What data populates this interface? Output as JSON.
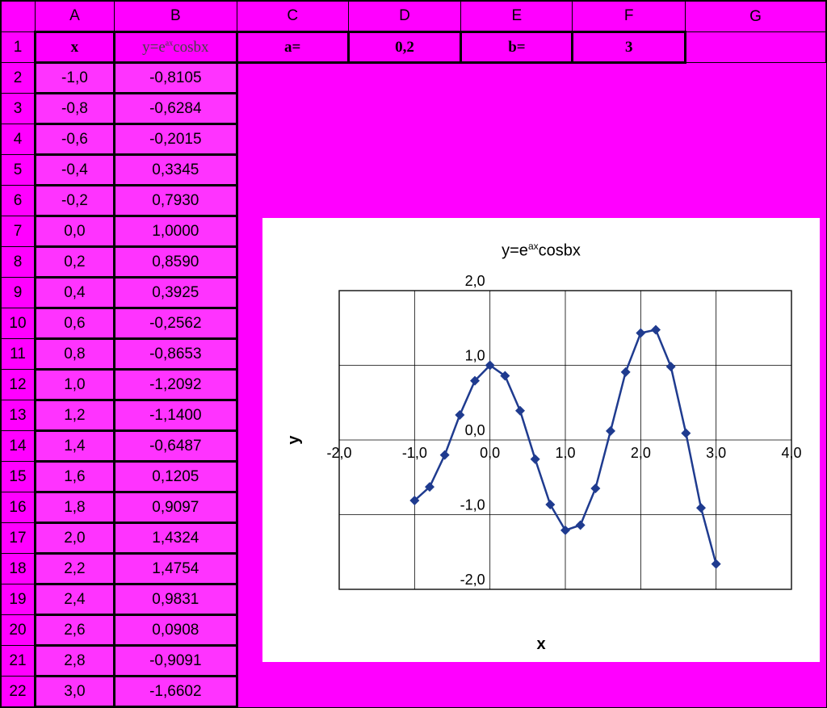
{
  "columns": [
    "A",
    "B",
    "C",
    "D",
    "E",
    "F",
    "G"
  ],
  "row_numbers": [
    1,
    2,
    3,
    4,
    5,
    6,
    7,
    8,
    9,
    10,
    11,
    12,
    13,
    14,
    15,
    16,
    17,
    18,
    19,
    20,
    21,
    22
  ],
  "header_row": {
    "A": "x",
    "B_html": "y=e<sup>ax</sup>cosbx",
    "C": "a=",
    "D": "0,2",
    "E": "b=",
    "F": "3"
  },
  "data_rows": [
    {
      "x": "-1,0",
      "y": "-0,8105"
    },
    {
      "x": "-0,8",
      "y": "-0,6284"
    },
    {
      "x": "-0,6",
      "y": "-0,2015"
    },
    {
      "x": "-0,4",
      "y": "0,3345"
    },
    {
      "x": "-0,2",
      "y": "0,7930"
    },
    {
      "x": "0,0",
      "y": "1,0000"
    },
    {
      "x": "0,2",
      "y": "0,8590"
    },
    {
      "x": "0,4",
      "y": "0,3925"
    },
    {
      "x": "0,6",
      "y": "-0,2562"
    },
    {
      "x": "0,8",
      "y": "-0,8653"
    },
    {
      "x": "1,0",
      "y": "-1,2092"
    },
    {
      "x": "1,2",
      "y": "-1,1400"
    },
    {
      "x": "1,4",
      "y": "-0,6487"
    },
    {
      "x": "1,6",
      "y": "0,1205"
    },
    {
      "x": "1,8",
      "y": "0,9097"
    },
    {
      "x": "2,0",
      "y": "1,4324"
    },
    {
      "x": "2,2",
      "y": "1,4754"
    },
    {
      "x": "2,4",
      "y": "0,9831"
    },
    {
      "x": "2,6",
      "y": "0,0908"
    },
    {
      "x": "2,8",
      "y": "-0,9091"
    },
    {
      "x": "3,0",
      "y": "-1,6602"
    }
  ],
  "chart_data": {
    "type": "line",
    "title_html": "y=e<sup>ax</sup>cosbx",
    "xlabel": "x",
    "ylabel": "y",
    "xlim": [
      -2,
      4
    ],
    "ylim": [
      -2,
      2
    ],
    "xticks": [
      "-2,0",
      "-1,0",
      "0,0",
      "1,0",
      "2,0",
      "3,0",
      "4,0"
    ],
    "yticks": [
      "-2,0",
      "-1,0",
      "0,0",
      "1,0",
      "2,0"
    ],
    "x": [
      -1.0,
      -0.8,
      -0.6,
      -0.4,
      -0.2,
      0.0,
      0.2,
      0.4,
      0.6,
      0.8,
      1.0,
      1.2,
      1.4,
      1.6,
      1.8,
      2.0,
      2.2,
      2.4,
      2.6,
      2.8,
      3.0
    ],
    "y": [
      -0.8105,
      -0.6284,
      -0.2015,
      0.3345,
      0.793,
      1.0,
      0.859,
      0.3925,
      -0.2562,
      -0.8653,
      -1.2092,
      -1.14,
      -0.6487,
      0.1205,
      0.9097,
      1.4324,
      1.4754,
      0.9831,
      0.0908,
      -0.9091,
      -1.6602
    ],
    "series_color": "#1f3b8f",
    "grid": true
  }
}
